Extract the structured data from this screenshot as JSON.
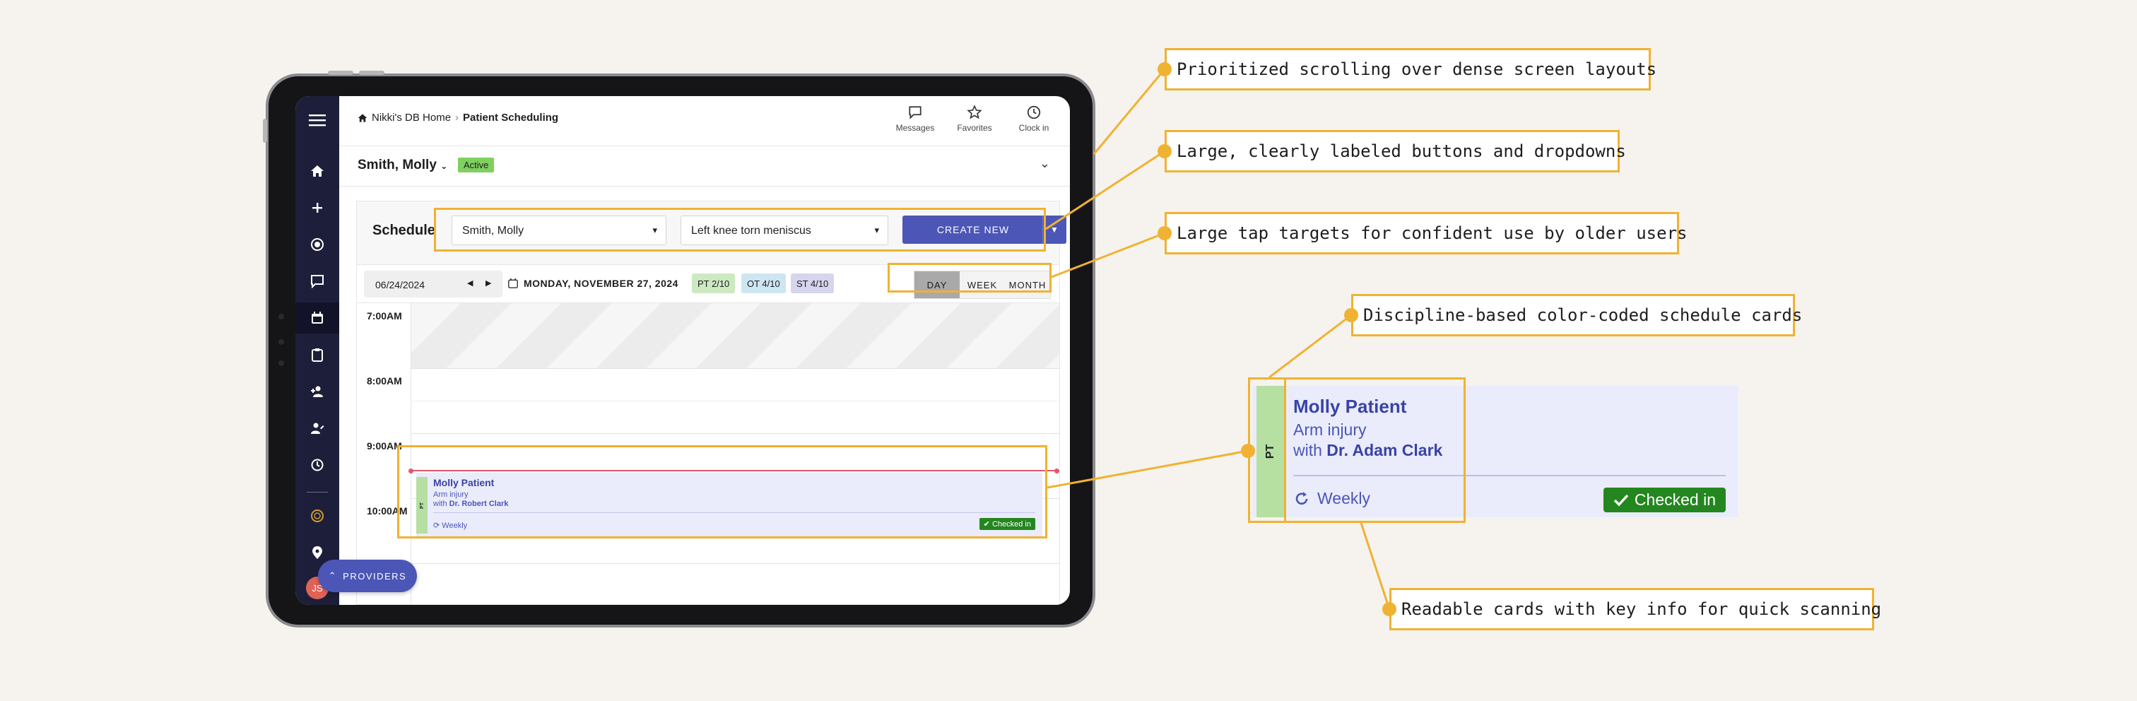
{
  "header": {
    "home_link": "Nikki's DB Home",
    "breadcrumb_sep": "›",
    "current_page": "Patient Scheduling",
    "actions": [
      {
        "label": "Messages",
        "icon": "chat-icon"
      },
      {
        "label": "Favorites",
        "icon": "star-icon"
      },
      {
        "label": "Clock in",
        "icon": "clock-icon"
      }
    ]
  },
  "patient": {
    "name": "Smith, Molly",
    "status": "Active"
  },
  "sidebar": {
    "items": [
      "menu-icon",
      "home-icon",
      "plus-icon",
      "record-icon",
      "chat-icon",
      "calendar-icon",
      "clipboard-icon",
      "person-add-icon",
      "person-edit-icon",
      "history-icon",
      "coin-icon",
      "location-icon"
    ],
    "avatar_initials": "JS"
  },
  "schedule": {
    "title": "Schedule",
    "patient_select": "Smith, Molly",
    "diagnosis_select": "Left knee torn meniscus",
    "create_label": "CREATE NEW",
    "date_value": "06/24/2024",
    "date_long": "MONDAY, NOVEMBER 27, 2024",
    "chips": [
      {
        "label": "PT 2/10",
        "color": "#cde9c2"
      },
      {
        "label": "OT 4/10",
        "color": "#cde6f2"
      },
      {
        "label": "ST 4/10",
        "color": "#d6d5ee"
      }
    ],
    "views": [
      "DAY",
      "WEEK",
      "MONTH"
    ],
    "selected_view": "DAY",
    "times": [
      "7:00AM",
      "8:00AM",
      "9:00AM",
      "10:00AM"
    ],
    "providers_label": "PROVIDERS"
  },
  "appointment": {
    "discipline": "PT",
    "name": "Molly Patient",
    "reason": "Arm injury",
    "with_prefix": "with",
    "doctor": "Dr. Robert Clark",
    "frequency": "Weekly",
    "status": "Checked in"
  },
  "zoom_card": {
    "discipline": "PT",
    "name": "Molly Patient",
    "reason": "Arm injury",
    "with_prefix": "with",
    "doctor": "Dr. Adam Clark",
    "frequency": "Weekly",
    "status": "Checked in"
  },
  "callouts": [
    "Prioritized scrolling over dense screen layouts",
    "Large, clearly labeled buttons and dropdowns",
    "Large tap targets for confident use by older users",
    "Discipline-based color-coded schedule cards",
    "Readable cards with key info for quick scanning"
  ],
  "colors": {
    "accent": "#f0b232",
    "primary": "#4b56b7",
    "success": "#24861f",
    "sidebar": "#1d1f3a"
  }
}
